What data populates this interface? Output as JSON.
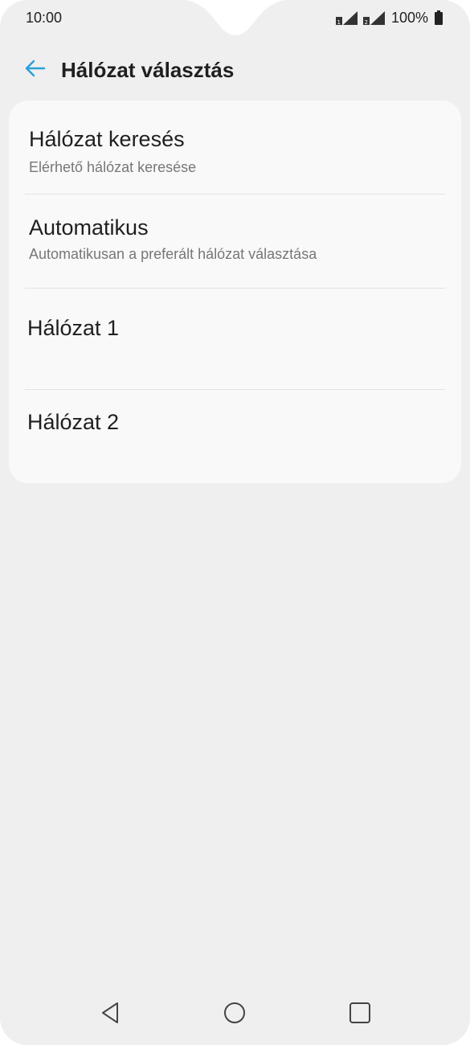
{
  "status_bar": {
    "time": "10:00",
    "battery_percent": "100%",
    "sim1_icon": "sim-signal-icon",
    "sim2_icon": "sim-signal-icon",
    "battery_icon": "battery-full-icon"
  },
  "app_bar": {
    "back_icon": "arrow-left-icon",
    "title": "Hálózat választás",
    "accent_color": "#2a9fd8"
  },
  "items": [
    {
      "title": "Hálózat keresés",
      "subtitle": "Elérhető hálózat keresése"
    },
    {
      "title": "Automatikus",
      "subtitle": "Automatikusan a preferált hálózat választása"
    },
    {
      "title": "Hálózat 1"
    },
    {
      "title": "Hálózat 2"
    }
  ],
  "nav_bar": {
    "back_icon": "triangle-back-icon",
    "home_icon": "circle-home-icon",
    "recents_icon": "square-recents-icon"
  }
}
